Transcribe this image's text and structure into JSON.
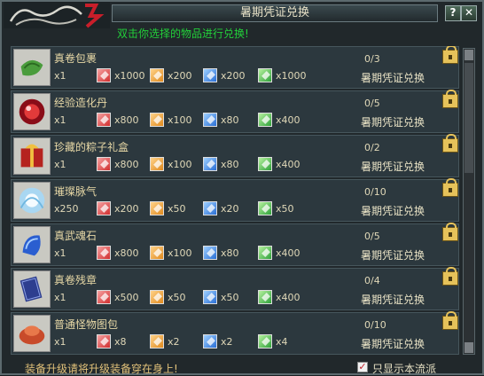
{
  "window": {
    "title": "暑期凭证兑换",
    "subtitle": "双击你选择的物品进行兑换!",
    "help_label": "?",
    "close_label": "✕"
  },
  "colors": {
    "red": "#d02d2d",
    "orange": "#e08a1e",
    "blue": "#2a6fd6",
    "green": "#2ea13a"
  },
  "items": [
    {
      "name": "真卷包裹",
      "qty": "x1",
      "progress": "0/3",
      "exchange": "暑期凭证兑换",
      "costs": [
        {
          "color": "red",
          "value": "x1000"
        },
        {
          "color": "orange",
          "value": "x200"
        },
        {
          "color": "blue",
          "value": "x200"
        },
        {
          "color": "green",
          "value": "x1000"
        }
      ]
    },
    {
      "name": "经验造化丹",
      "qty": "x1",
      "progress": "0/5",
      "exchange": "暑期凭证兑换",
      "costs": [
        {
          "color": "red",
          "value": "x800"
        },
        {
          "color": "orange",
          "value": "x100"
        },
        {
          "color": "blue",
          "value": "x80"
        },
        {
          "color": "green",
          "value": "x400"
        }
      ]
    },
    {
      "name": "珍藏的粽子礼盒",
      "qty": "x1",
      "progress": "0/2",
      "exchange": "暑期凭证兑换",
      "costs": [
        {
          "color": "red",
          "value": "x800"
        },
        {
          "color": "orange",
          "value": "x100"
        },
        {
          "color": "blue",
          "value": "x80"
        },
        {
          "color": "green",
          "value": "x400"
        }
      ]
    },
    {
      "name": "璀璨脉气",
      "qty": "x250",
      "progress": "0/10",
      "exchange": "暑期凭证兑换",
      "costs": [
        {
          "color": "red",
          "value": "x200"
        },
        {
          "color": "orange",
          "value": "x50"
        },
        {
          "color": "blue",
          "value": "x20"
        },
        {
          "color": "green",
          "value": "x50"
        }
      ]
    },
    {
      "name": "真武魂石",
      "qty": "x1",
      "progress": "0/5",
      "exchange": "暑期凭证兑换",
      "costs": [
        {
          "color": "red",
          "value": "x800"
        },
        {
          "color": "orange",
          "value": "x100"
        },
        {
          "color": "blue",
          "value": "x80"
        },
        {
          "color": "green",
          "value": "x400"
        }
      ]
    },
    {
      "name": "真卷残章",
      "qty": "x1",
      "progress": "0/4",
      "exchange": "暑期凭证兑换",
      "costs": [
        {
          "color": "red",
          "value": "x500"
        },
        {
          "color": "orange",
          "value": "x50"
        },
        {
          "color": "blue",
          "value": "x50"
        },
        {
          "color": "green",
          "value": "x400"
        }
      ]
    },
    {
      "name": "普通怪物图包",
      "qty": "x1",
      "progress": "0/10",
      "exchange": "暑期凭证兑换",
      "costs": [
        {
          "color": "red",
          "value": "x8"
        },
        {
          "color": "orange",
          "value": "x2"
        },
        {
          "color": "blue",
          "value": "x2"
        },
        {
          "color": "green",
          "value": "x4"
        }
      ]
    }
  ],
  "footer": {
    "tip": "装备升级请将升级装备穿在身上!",
    "filter_label": "只显示本流派",
    "filter_checked": true
  }
}
